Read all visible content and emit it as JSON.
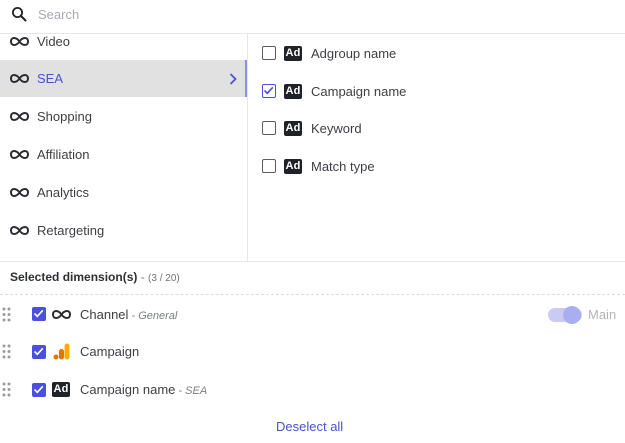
{
  "search": {
    "placeholder": "Search",
    "value": ""
  },
  "channels": [
    {
      "label": "Video",
      "icon": "infinity-icon"
    },
    {
      "label": "SEA",
      "icon": "infinity-icon",
      "active": true
    },
    {
      "label": "Shopping",
      "icon": "infinity-icon"
    },
    {
      "label": "Affiliation",
      "icon": "infinity-icon"
    },
    {
      "label": "Analytics",
      "icon": "infinity-icon"
    },
    {
      "label": "Retargeting",
      "icon": "infinity-icon"
    }
  ],
  "dimensions": [
    {
      "label": "Adgroup name",
      "badge": "Ad",
      "checked": false
    },
    {
      "label": "Campaign name",
      "badge": "Ad",
      "checked": true
    },
    {
      "label": "Keyword",
      "badge": "Ad",
      "checked": false
    },
    {
      "label": "Match type",
      "badge": "Ad",
      "checked": false
    }
  ],
  "selected": {
    "title": "Selected dimension(s)",
    "count_sep": " - ",
    "count": "(3 / 20)",
    "items": [
      {
        "name": "Channel",
        "context": "General",
        "context_sep": " - ",
        "icon": "infinity-icon",
        "checked": true
      },
      {
        "name": "Campaign",
        "context": "",
        "context_sep": "",
        "icon": "google-analytics-icon",
        "checked": true
      },
      {
        "name": "Campaign name",
        "context": "SEA",
        "context_sep": " - ",
        "icon": "ad-badge-icon",
        "badge": "Ad",
        "checked": true
      }
    ],
    "main_toggle": {
      "label": "Main",
      "on": true
    }
  },
  "deselect_label": "Deselect all",
  "colors": {
    "accent": "#4b4fe0",
    "link": "#4a53c9",
    "active_bg": "#e1e1e1",
    "badge_bg": "#1f2229",
    "toggle_track": "#c9cbf4",
    "toggle_knob": "#a9aef0"
  }
}
